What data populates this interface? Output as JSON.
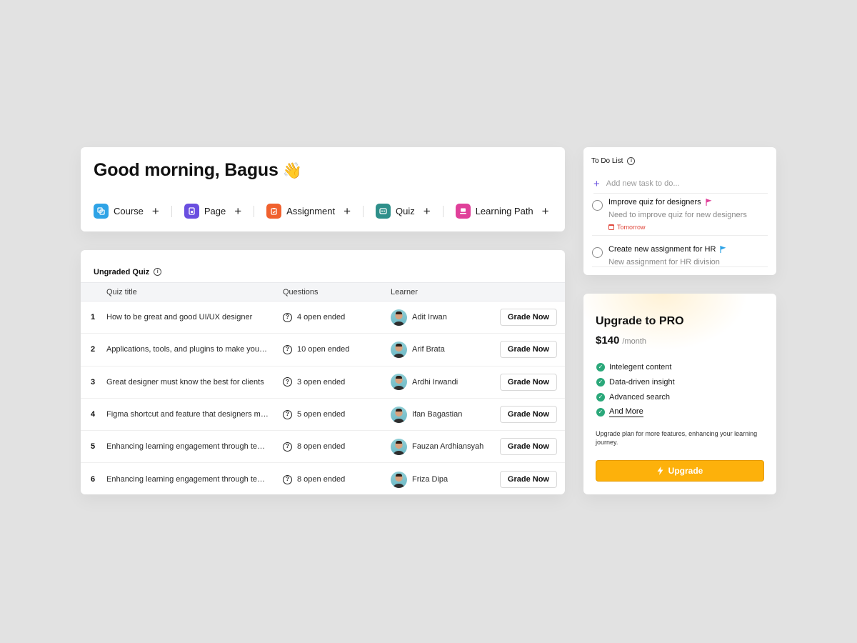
{
  "greeting": {
    "title": "Good morning, Bagus",
    "emoji": "👋"
  },
  "quick_actions": [
    {
      "label": "Course",
      "icon": "course-icon",
      "color": "#2ea3e6"
    },
    {
      "label": "Page",
      "icon": "page-icon",
      "color": "#6a4fe0"
    },
    {
      "label": "Assignment",
      "icon": "assignment-icon",
      "color": "#f0612e"
    },
    {
      "label": "Quiz",
      "icon": "quiz-icon",
      "color": "#2e8f8a"
    },
    {
      "label": "Learning Path",
      "icon": "learning-path-icon",
      "color": "#e0409a"
    }
  ],
  "ungraded_quiz": {
    "title": "Ungraded Quiz",
    "columns": {
      "title": "Quiz title",
      "questions": "Questions",
      "learner": "Learner"
    },
    "button_label": "Grade Now",
    "rows": [
      {
        "num": "1",
        "title": "How to be great and good UI/UX designer",
        "questions": "4 open ended",
        "learner": "Adit Irwan"
      },
      {
        "num": "2",
        "title": "Applications, tools, and plugins to make your work easier",
        "questions": "10 open ended",
        "learner": "Arif Brata"
      },
      {
        "num": "3",
        "title": "Great designer must know the best for clients",
        "questions": "3 open ended",
        "learner": "Ardhi Irwandi"
      },
      {
        "num": "4",
        "title": "Figma shortcut and feature that designers must know",
        "questions": "5 open ended",
        "learner": "Ifan Bagastian"
      },
      {
        "num": "5",
        "title": "Enhancing learning engagement through technology",
        "questions": "8 open ended",
        "learner": "Fauzan Ardhiansyah"
      },
      {
        "num": "6",
        "title": "Enhancing learning engagement through technology",
        "questions": "8 open ended",
        "learner": "Friza Dipa"
      }
    ]
  },
  "todo": {
    "title": "To Do List",
    "placeholder": "Add new task to do...",
    "items": [
      {
        "title": "Improve quiz for designers",
        "description": "Need to improve quiz for new designers",
        "due": "Tomorrow",
        "flag_color": "#e0409a"
      },
      {
        "title": "Create new assignment for HR",
        "description": "New assignment for HR division",
        "due": "",
        "flag_color": "#2ea3e6"
      }
    ]
  },
  "pro": {
    "title": "Upgrade to PRO",
    "price": "$140",
    "period": "/month",
    "features": [
      "Intelegent content",
      "Data-driven insight",
      "Advanced search"
    ],
    "more_link": "And More",
    "description": "Upgrade plan for more features, enhancing your learning journey.",
    "button_label": "Upgrade",
    "accent_color": "#fdb10b",
    "check_color": "#2ba87a"
  }
}
